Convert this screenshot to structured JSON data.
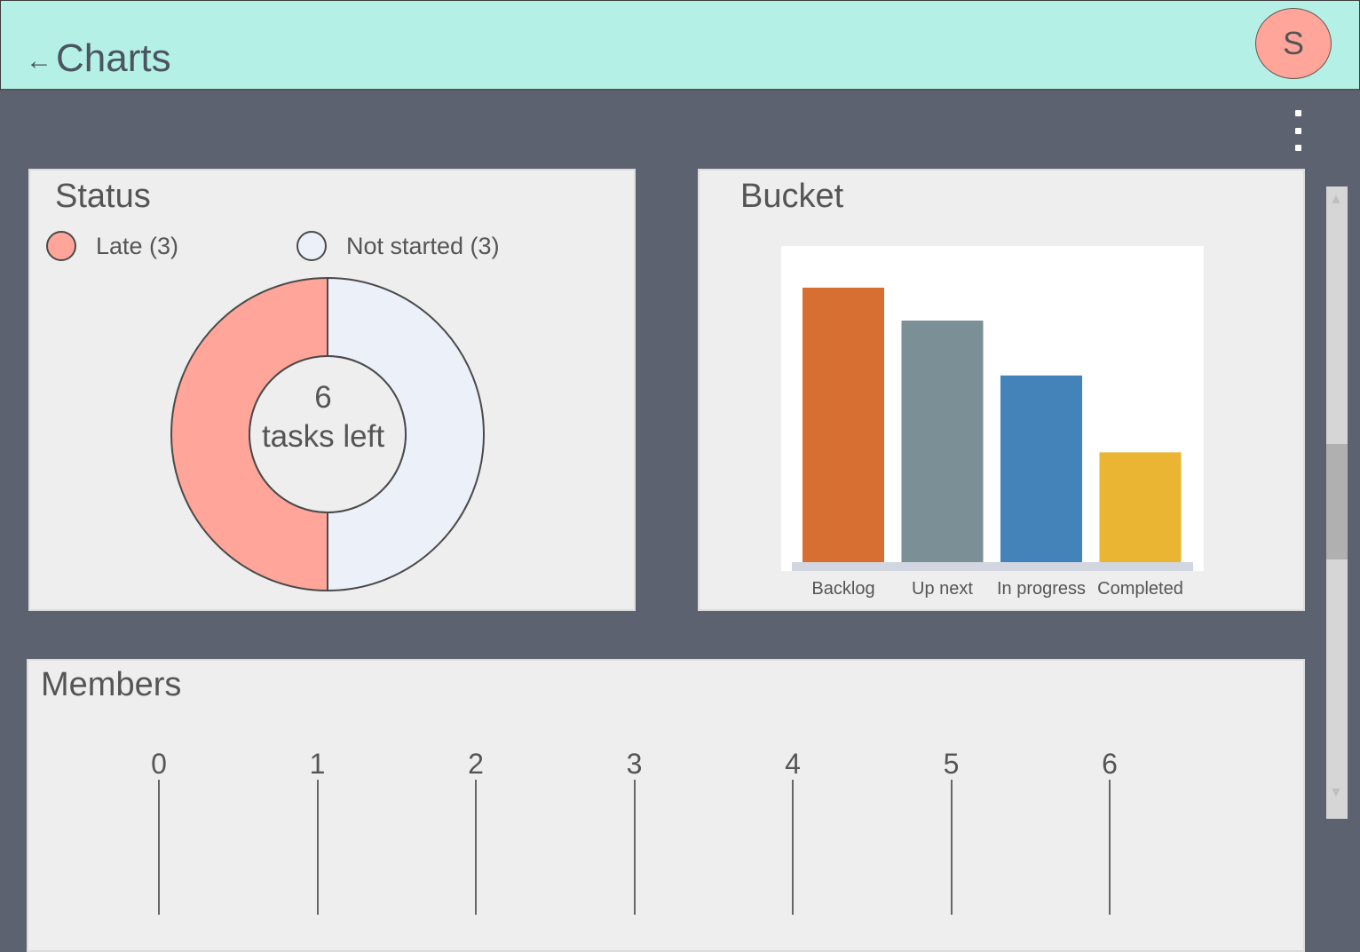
{
  "header": {
    "back_arrow": "←",
    "title": "Charts",
    "avatar_initial": "S",
    "background": "#b5f0e6"
  },
  "status_panel": {
    "title": "Status",
    "legend": [
      {
        "label": "Late (3)",
        "color": "#ffa59a"
      },
      {
        "label": "Not started (3)",
        "color": "#ecf0f9"
      }
    ],
    "center_count": "6",
    "center_text": "tasks left"
  },
  "bucket_panel": {
    "title": "Bucket"
  },
  "members_panel": {
    "title": "Members",
    "axis_ticks": [
      "0",
      "1",
      "2",
      "3",
      "4",
      "5",
      "6"
    ]
  },
  "chart_data": [
    {
      "type": "pie",
      "variant": "donut",
      "title": "Status",
      "categories": [
        "Late",
        "Not started"
      ],
      "values": [
        3,
        3
      ],
      "colors": [
        "#ffa59a",
        "#ecf0f9"
      ]
    },
    {
      "type": "bar",
      "title": "Bucket",
      "categories": [
        "Backlog",
        "Up next",
        "In progress",
        "Completed"
      ],
      "values": [
        5,
        4.4,
        3.4,
        2
      ],
      "colors": [
        "#d86f32",
        "#7b8f96",
        "#4483ba",
        "#e9b532"
      ],
      "ylim": [
        0,
        5.5
      ],
      "grid": false
    },
    {
      "type": "bar",
      "orientation": "horizontal",
      "title": "Members",
      "x_ticks": [
        0,
        1,
        2,
        3,
        4,
        5,
        6
      ],
      "xlim": [
        0,
        6
      ]
    }
  ]
}
